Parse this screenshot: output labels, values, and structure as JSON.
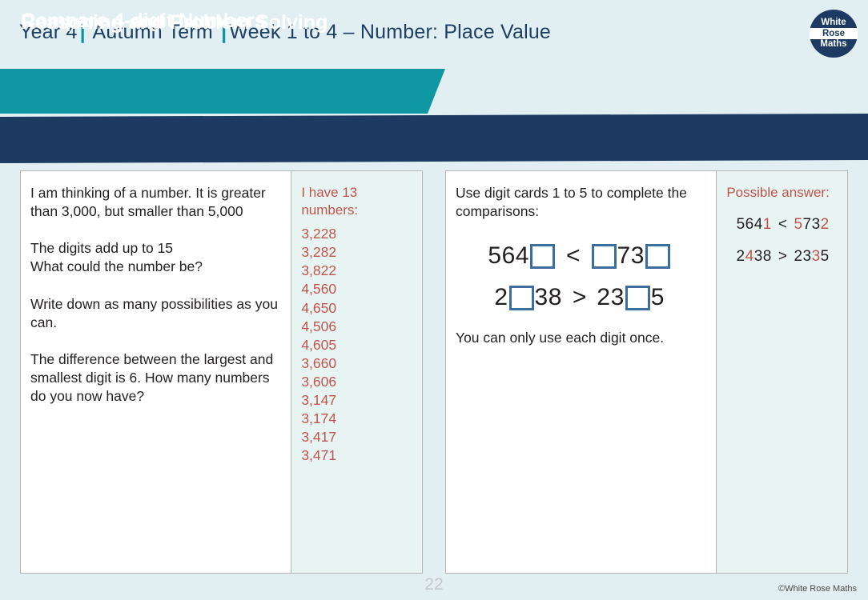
{
  "header": {
    "year": "Year 4",
    "term": "Autumn Term",
    "week_topic": "Week 1 to 4 – Number: Place Value",
    "separator": "|",
    "logo": {
      "line1": "White",
      "line2": "Rose",
      "line3": "Maths"
    }
  },
  "banners": {
    "lesson_title": "Compare 4-digit Numbers",
    "section_title": "Reasoning and Problem Solving"
  },
  "left_card": {
    "question": "I am thinking of a number. It is greater than 3,000, but smaller than 5,000\n\nThe digits add up to 15\nWhat could the number be?\n\nWrite down as many possibilities as you can.\n\nThe difference between the largest and smallest digit is 6. How many numbers do you now have?",
    "answer_heading": "I have 13 numbers:",
    "answer_numbers": [
      "3,228",
      "3,282",
      "3,822",
      "4,560",
      "4,650",
      "4,506",
      "4,605",
      "3,660",
      "3,606",
      "3,147",
      "3,174",
      "3,417",
      "3,471"
    ]
  },
  "right_card": {
    "question_intro": "Use digit cards 1 to 5 to complete the comparisons:",
    "expression_1": {
      "part_a": "564",
      "operator": "<",
      "part_b": "73",
      "boxes": 3
    },
    "expression_2": {
      "part_a": "2",
      "part_b": "38",
      "operator": ">",
      "part_c": "23",
      "part_d": "5"
    },
    "question_note": "You can only use each digit once.",
    "answer_heading": "Possible answer:",
    "answer_line_1": {
      "left_black": "564",
      "left_red": "1",
      "operator": "<",
      "right_red_1": "5",
      "right_black": "73",
      "right_red_2": "2"
    },
    "answer_line_2": {
      "left_black_1": "2",
      "left_red": "4",
      "left_black_2": "38",
      "operator": ">",
      "right_black_1": "23",
      "right_red": "3",
      "right_black_2": "5"
    }
  },
  "footer": {
    "page_number": "22",
    "copyright": "©White Rose Maths"
  },
  "colors": {
    "page_background": "#e2eff2",
    "navy": "#1d3a63",
    "teal": "#0e96a2",
    "answer_red": "#c0544f",
    "answer_panel_bg": "#e7f4f2",
    "digit_box_border": "#3b6d9e"
  }
}
